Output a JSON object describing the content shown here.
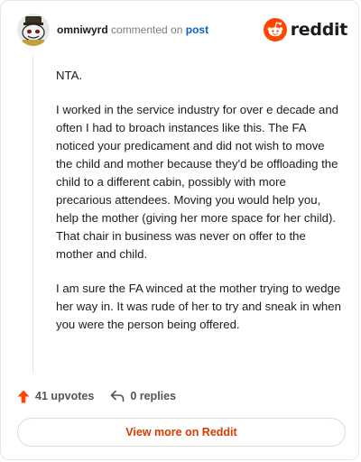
{
  "header": {
    "username": "omniwyrd",
    "verb": "commented on",
    "link_text": "post",
    "brand_name": "reddit",
    "avatar_icon": "snoo-avatar-icon",
    "brand_icon": "reddit-logo-icon"
  },
  "comment": {
    "paragraphs": [
      "NTA.",
      "I worked in the service industry for over e decade and often I had to broach instances like this. The FA noticed your predicament and did not wish to move the child and mother because they'd be offloading the child to a different cabin, possibly with more precarious attendees. Moving you would help you, help the mother (giving her more space for her child). That chair in business was never on offer to the mother and child.",
      "I am sure the FA winced at the mother trying to wedge her way in. It was rude of her to try and sneak in when you were the person being offered."
    ]
  },
  "footer": {
    "upvotes": "41 upvotes",
    "replies": "0 replies",
    "upvote_icon": "upvote-arrow-icon",
    "reply_icon": "reply-arrow-icon"
  },
  "actions": {
    "view_more": "View more on Reddit"
  },
  "colors": {
    "accent": "#ff4500",
    "link": "#0b5ecd",
    "view_more_text": "#d93a00"
  }
}
